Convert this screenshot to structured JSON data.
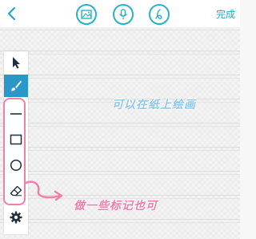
{
  "header": {
    "back_icon": "chevron-left-icon",
    "image_icon": "image-icon",
    "mic_icon": "microphone-icon",
    "pen_icon": "handwriting-icon",
    "done_label": "完成"
  },
  "toolbar": {
    "tools": [
      {
        "name": "select",
        "icon": "cursor-arrow-icon"
      },
      {
        "name": "brush",
        "icon": "brush-icon",
        "active": true
      },
      {
        "name": "line",
        "icon": "line-icon"
      },
      {
        "name": "rectangle",
        "icon": "rectangle-icon"
      },
      {
        "name": "circle",
        "icon": "circle-icon"
      },
      {
        "name": "eraser",
        "icon": "eraser-icon"
      },
      {
        "name": "settings",
        "icon": "gear-icon"
      }
    ]
  },
  "annotations": {
    "draw_on_paper": "可以在纸上绘画",
    "make_marks": "做一些标记也可"
  },
  "colors": {
    "accent": "#23a9c2",
    "active_tool": "#2a97c9",
    "annotation_blue": "#8fc7ea",
    "annotation_pink": "#f07ea8"
  }
}
